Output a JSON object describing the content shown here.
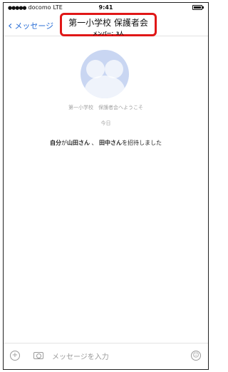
{
  "status": {
    "carrier": "docomo",
    "network": "LTE",
    "time": "9:41"
  },
  "nav": {
    "back_label": "メッセージ",
    "title": "第一小学校 保護者会",
    "subtitle": "メンバー：3人"
  },
  "chat": {
    "welcome": "第一小学校　保護者会へようこそ",
    "date": "今日",
    "system": {
      "inviter": "自分",
      "p1": "が",
      "user1": "山田さん",
      "sep": " 、 ",
      "user2": "田中さん",
      "p2": "を招待しました"
    }
  },
  "input": {
    "placeholder": "メッセージを入力"
  },
  "colors": {
    "accent": "#2b6fd6",
    "highlight": "#e01717"
  }
}
